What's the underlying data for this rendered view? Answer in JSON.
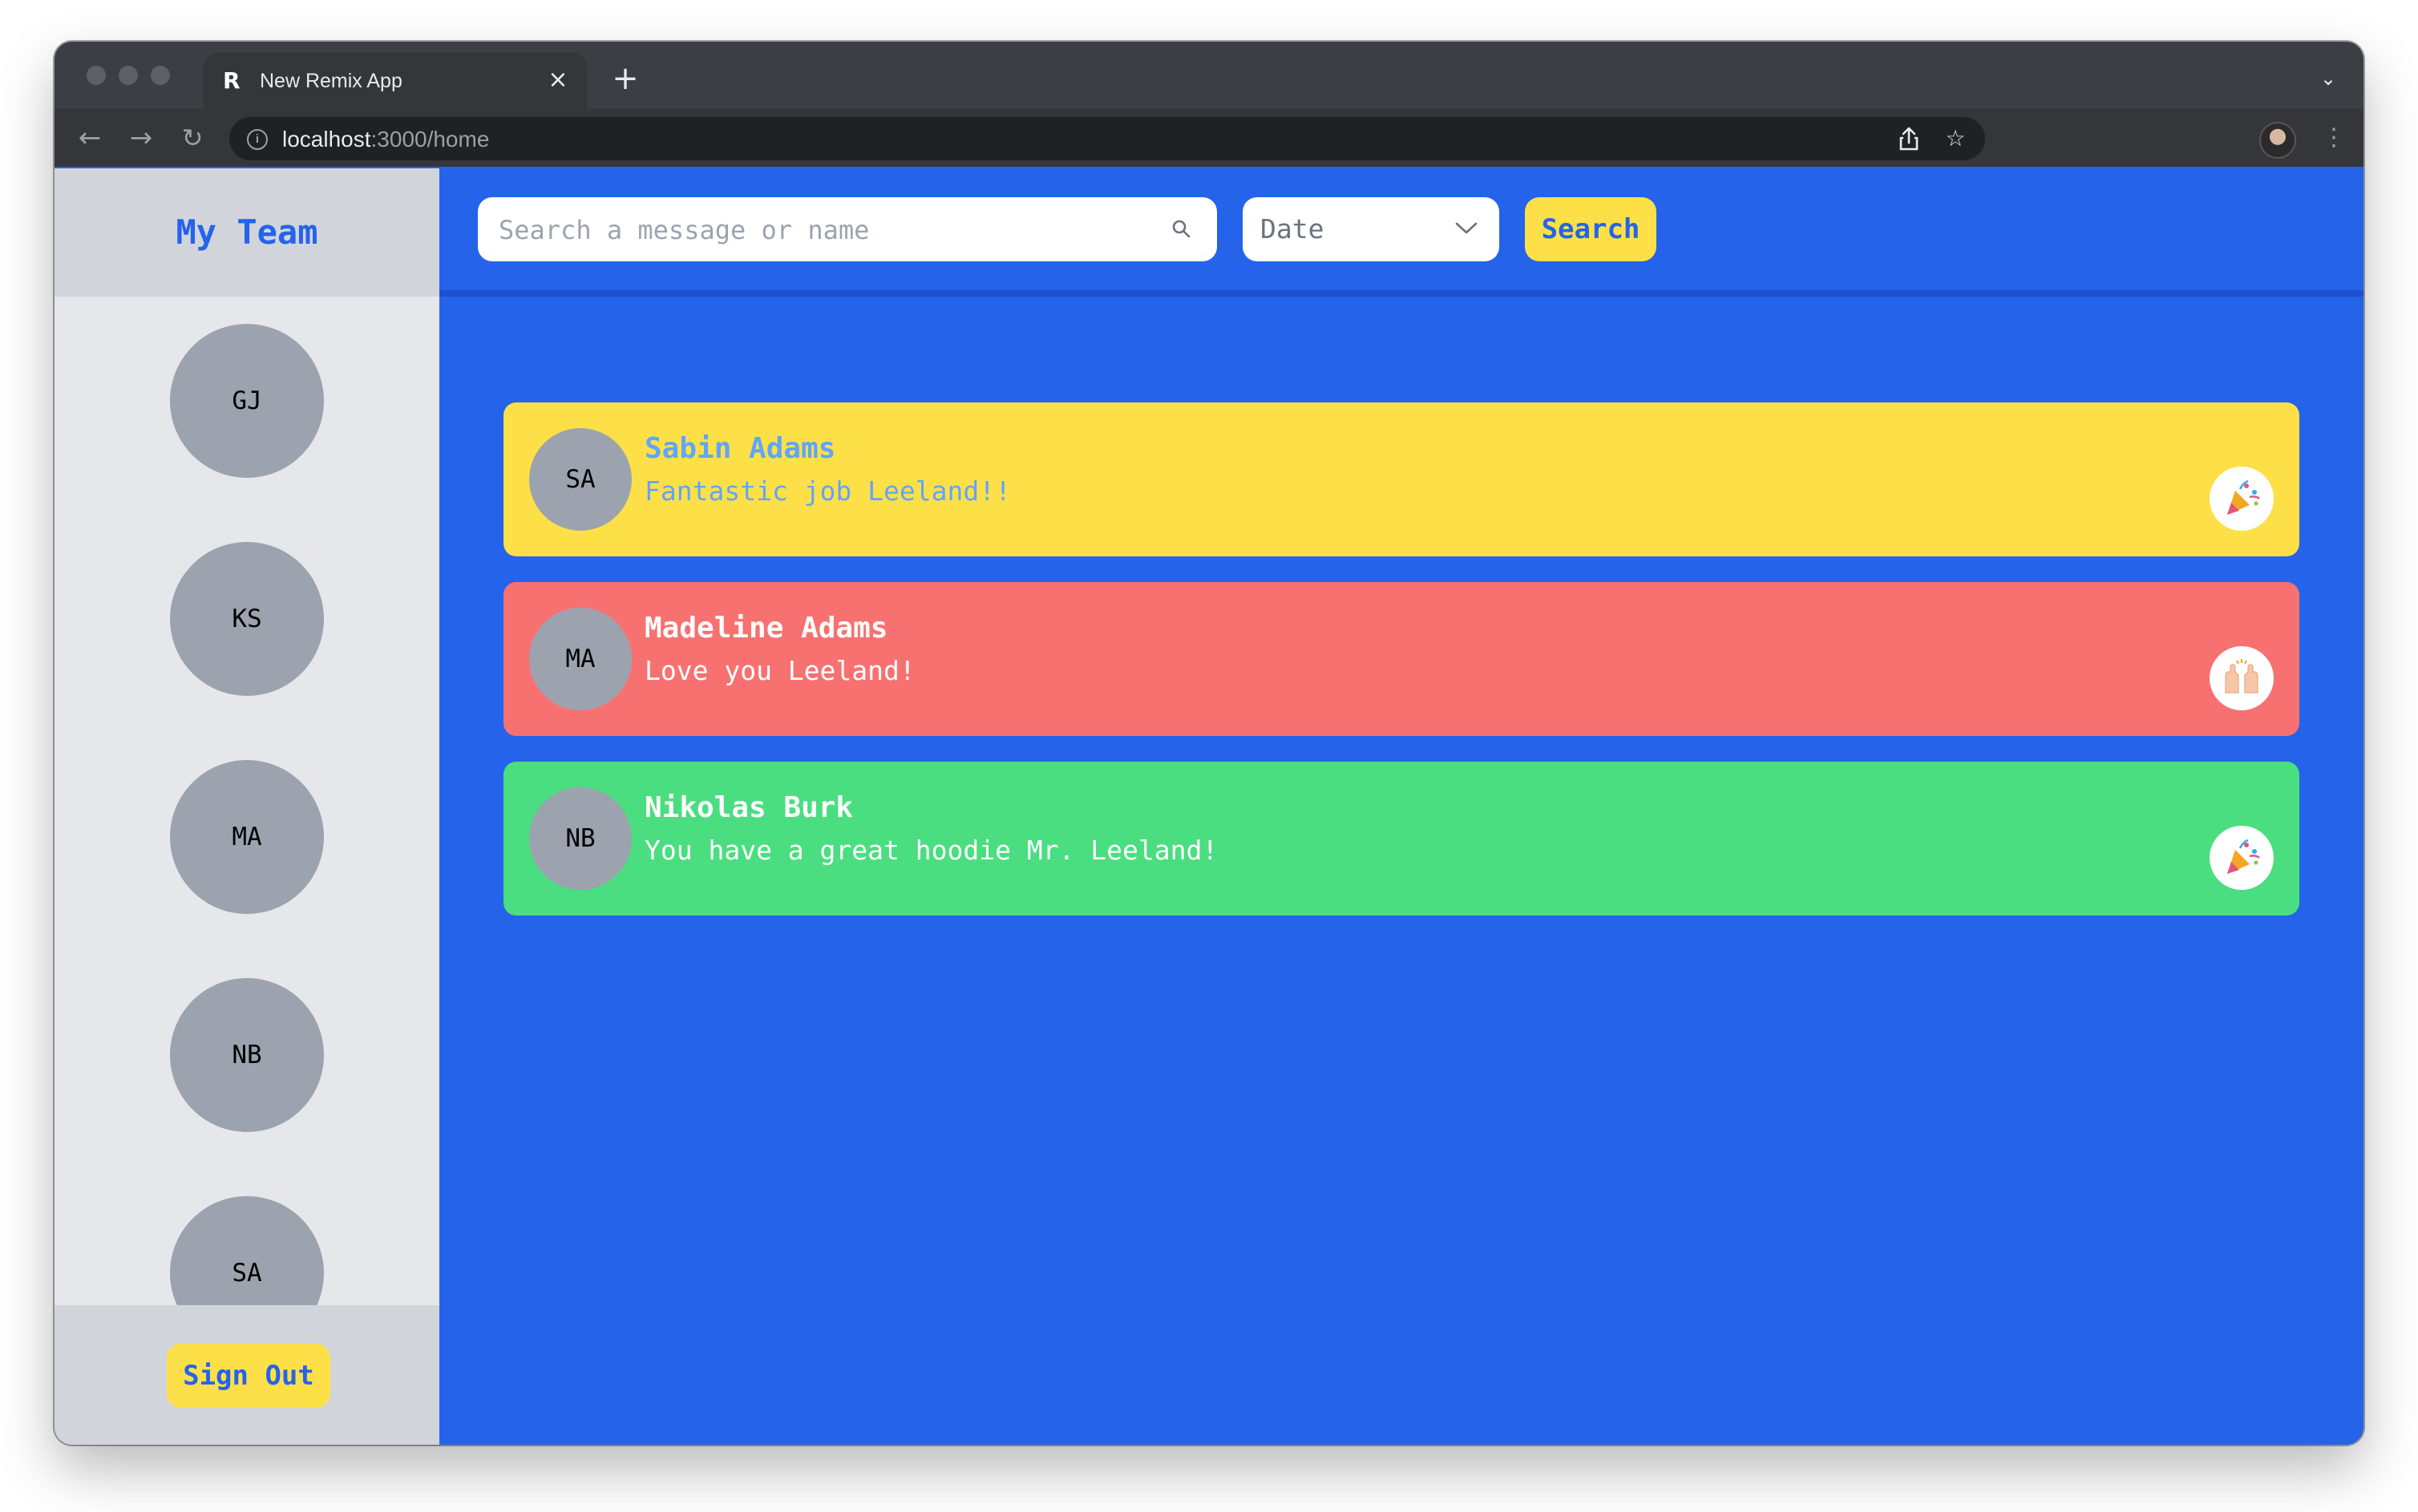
{
  "browser": {
    "tab_title": "New Remix App",
    "url_host": "localhost",
    "url_path": ":3000/home"
  },
  "sidebar": {
    "title": "My Team",
    "members": [
      {
        "initials": "GJ"
      },
      {
        "initials": "KS"
      },
      {
        "initials": "MA"
      },
      {
        "initials": "NB"
      },
      {
        "initials": "SA"
      }
    ],
    "signout_label": "Sign Out"
  },
  "toolbar": {
    "search_placeholder": "Search a message or name",
    "date_selected": "Date",
    "search_label": "Search"
  },
  "kudos": [
    {
      "initials": "SA",
      "name": "Sabin Adams",
      "message": "Fantastic job Leeland!!",
      "background": "#fde047",
      "text_color": "#60a5fa",
      "emoji": "party-popper-icon"
    },
    {
      "initials": "MA",
      "name": "Madeline Adams",
      "message": "Love you Leeland!",
      "background": "#f87171",
      "text_color": "#ffffff",
      "emoji": "raised-hands-icon"
    },
    {
      "initials": "NB",
      "name": "Nikolas Burk",
      "message": "You have a great hoodie Mr. Leeland!",
      "background": "#4ade80",
      "text_color": "#ffffff",
      "emoji": "party-popper-icon"
    }
  ],
  "colors": {
    "primary": "#2563eb",
    "accent_yellow": "#fde047",
    "sidebar_bg": "#e5e7eb",
    "avatar_gray": "#9ca3af"
  }
}
